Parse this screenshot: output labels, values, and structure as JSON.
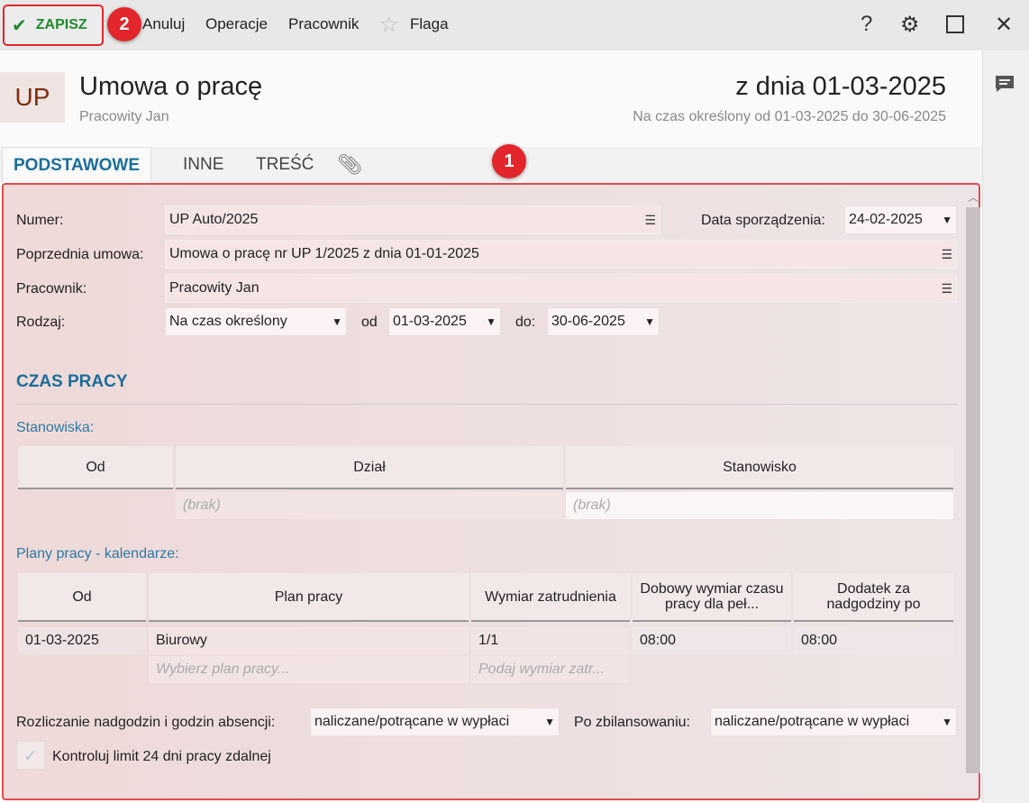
{
  "toolbar": {
    "save": "ZAPISZ",
    "cancel": "Anuluj",
    "operations": "Operacje",
    "employee": "Pracownik",
    "flag": "Flaga",
    "help": "?",
    "badge1": "1",
    "badge2": "2"
  },
  "header": {
    "avatar": "UP",
    "title": "Umowa o pracę",
    "subtitle": "Pracowity Jan",
    "date": "z dnia 01-03-2025",
    "period": "Na czas określony od 01-03-2025 do 30-06-2025"
  },
  "tabs": [
    "PODSTAWOWE",
    "INNE",
    "TREŚĆ"
  ],
  "form": {
    "numer_label": "Numer:",
    "numer": "UP Auto/2025",
    "data_label": "Data sporządzenia:",
    "data": "24-02-2025",
    "poprz_label": "Poprzednia umowa:",
    "poprz": "Umowa o pracę nr UP 1/2025 z dnia 01-01-2025",
    "prac_label": "Pracownik:",
    "prac": "Pracowity Jan",
    "rodzaj_label": "Rodzaj:",
    "rodzaj": "Na czas określony",
    "od_label": "od",
    "od": "01-03-2025",
    "do_label": "do:",
    "do": "30-06-2025"
  },
  "czas": {
    "title": "CZAS PRACY",
    "stanowiska": "Stanowiska:",
    "st_headers": [
      "Od",
      "Dział",
      "Stanowisko"
    ],
    "st_empty": "(brak)",
    "plany": "Plany pracy - kalendarze:",
    "pl_headers": [
      "Od",
      "Plan pracy",
      "Wymiar zatrudnienia",
      "Dobowy wymiar czasu pracy dla peł...",
      "Dodatek za nadgodziny po"
    ],
    "pl_row": [
      "01-03-2025",
      "Biurowy",
      "1/1",
      "08:00",
      "08:00"
    ],
    "pl_ph1": "Wybierz plan pracy...",
    "pl_ph2": "Podaj wymiar zatr...",
    "rozl_label": "Rozliczanie nadgodzin i godzin absencji:",
    "rozl": "naliczane/potrącane w wypłaci",
    "po_label": "Po zbilansowaniu:",
    "po": "naliczane/potrącane w wypłaci",
    "limit": "Kontroluj limit 24 dni pracy zdalnej"
  }
}
